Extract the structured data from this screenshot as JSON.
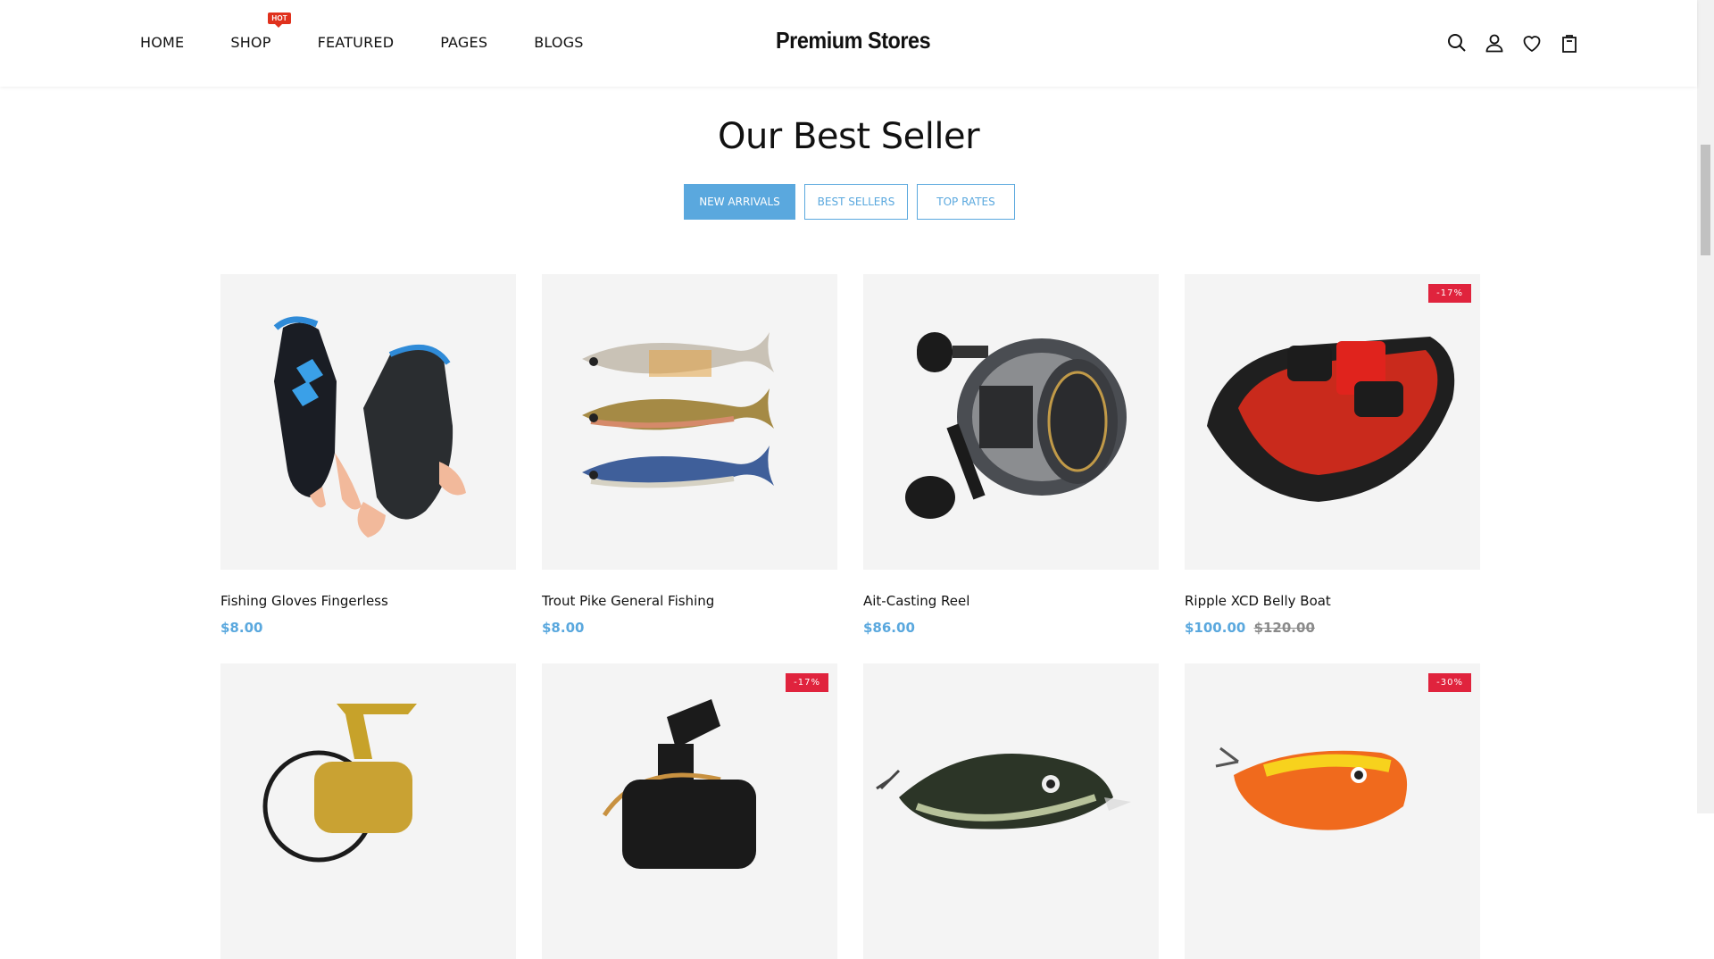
{
  "header": {
    "nav": [
      {
        "label": "HOME"
      },
      {
        "label": "SHOP",
        "badge": "HOT"
      },
      {
        "label": "FEATURED"
      },
      {
        "label": "PAGES"
      },
      {
        "label": "BLOGS"
      }
    ],
    "logo": "Premium Stores",
    "icons": [
      "search-icon",
      "user-icon",
      "heart-icon",
      "bag-icon"
    ]
  },
  "section": {
    "title": "Our Best Seller",
    "tabs": [
      "NEW ARRIVALS",
      "BEST SELLERS",
      "TOP RATES"
    ]
  },
  "products": [
    {
      "name": "Fishing Gloves Fingerless",
      "price": "$8.00",
      "old_price": "",
      "badge": ""
    },
    {
      "name": "Trout Pike General Fishing",
      "price": "$8.00",
      "old_price": "",
      "badge": ""
    },
    {
      "name": "Ait-Casting Reel",
      "price": "$86.00",
      "old_price": "",
      "badge": ""
    },
    {
      "name": "Ripple XCD Belly Boat",
      "price": "$100.00",
      "old_price": "$120.00",
      "badge": "-17%"
    },
    {
      "name": "",
      "price": "",
      "old_price": "",
      "badge": ""
    },
    {
      "name": "",
      "price": "",
      "old_price": "",
      "badge": "-17%"
    },
    {
      "name": "",
      "price": "",
      "old_price": "",
      "badge": ""
    },
    {
      "name": "",
      "price": "",
      "old_price": "",
      "badge": "-30%"
    }
  ],
  "colors": {
    "accent": "#5aa8de",
    "sale": "#e0233d",
    "hot": "#e0311d"
  }
}
